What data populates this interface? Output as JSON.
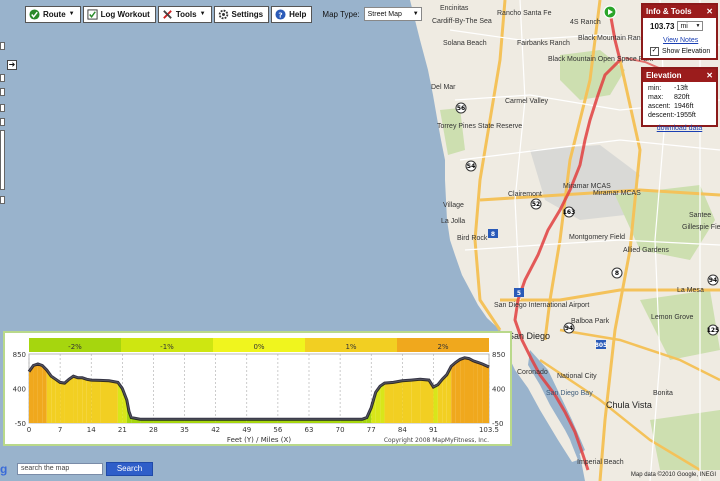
{
  "toolbar": {
    "route": "Route",
    "log_workout": "Log Workout",
    "tools": "Tools",
    "settings": "Settings",
    "help": "Help",
    "map_type_label": "Map Type:",
    "map_type_value": "Street Map"
  },
  "info_panel": {
    "title": "Info & Tools",
    "distance": "103.73",
    "unit": "mi",
    "view_notes": "View Notes",
    "show_elevation": "Show Elevation"
  },
  "elevation_panel": {
    "title": "Elevation",
    "min_label": "min:",
    "min_value": "-13ft",
    "max_label": "max:",
    "max_value": "820ft",
    "ascent_label": "ascent:",
    "ascent_value": "1946ft",
    "descent_label": "descent:",
    "descent_value": "-1955ft",
    "download": "download data"
  },
  "map_labels": [
    {
      "text": "Encinitas",
      "cls": ""
    },
    {
      "text": "Cardiff-By-The Sea",
      "cls": ""
    },
    {
      "text": "Rancho Santa Fe",
      "cls": ""
    },
    {
      "text": "4S Ranch",
      "cls": ""
    },
    {
      "text": "Solana Beach",
      "cls": ""
    },
    {
      "text": "Fairbanks Ranch",
      "cls": ""
    },
    {
      "text": "Black Mountain Ranch",
      "cls": ""
    },
    {
      "text": "Black Mountain Open Space Park",
      "cls": ""
    },
    {
      "text": "Del Mar",
      "cls": ""
    },
    {
      "text": "Carmel Valley",
      "cls": ""
    },
    {
      "text": "Torrey Pines State Reserve",
      "cls": ""
    },
    {
      "text": "Miramar MCAS",
      "cls": ""
    },
    {
      "text": "Miramar MCAS",
      "cls": ""
    },
    {
      "text": "Village",
      "cls": ""
    },
    {
      "text": "La Jolla",
      "cls": ""
    },
    {
      "text": "Bird Rock",
      "cls": ""
    },
    {
      "text": "Clairemont",
      "cls": ""
    },
    {
      "text": "Montgomery Field",
      "cls": ""
    },
    {
      "text": "Allied Gardens",
      "cls": ""
    },
    {
      "text": "Santee",
      "cls": ""
    },
    {
      "text": "Gillespie Field",
      "cls": ""
    },
    {
      "text": "La Mesa",
      "cls": ""
    },
    {
      "text": "Lemon Grove",
      "cls": ""
    },
    {
      "text": "San Diego International Airport",
      "cls": ""
    },
    {
      "text": "Balboa Park",
      "cls": ""
    },
    {
      "text": "San Diego",
      "cls": "big"
    },
    {
      "text": "Coronado",
      "cls": ""
    },
    {
      "text": "National City",
      "cls": ""
    },
    {
      "text": "San Diego Bay",
      "cls": "water"
    },
    {
      "text": "Chula Vista",
      "cls": "big"
    },
    {
      "text": "Bonita",
      "cls": ""
    },
    {
      "text": "Imperial Beach",
      "cls": ""
    }
  ],
  "chart_data": {
    "type": "area",
    "title": "",
    "xlabel": "Feet (Y) / Miles (X)",
    "ylabel": "",
    "copyright": "Copyright 2008 MapMyFitness, Inc.",
    "x_ticks": [
      "0",
      "7",
      "14",
      "21",
      "28",
      "35",
      "42",
      "49",
      "56",
      "63",
      "70",
      "77",
      "84",
      "91",
      "103.5"
    ],
    "y_ticks": [
      "850",
      "400",
      "-50"
    ],
    "y_ticks_right": [
      "850",
      "400",
      "-50"
    ],
    "ylim": [
      -50,
      850
    ],
    "xlim": [
      0,
      103.5
    ],
    "grade_bands": [
      {
        "label": "-2%",
        "color": "#a6d60e"
      },
      {
        "label": "-1%",
        "color": "#cee611"
      },
      {
        "label": "0%",
        "color": "#f0f51e"
      },
      {
        "label": "1%",
        "color": "#f2cf22"
      },
      {
        "label": "2%",
        "color": "#f0a81d"
      }
    ],
    "series": [
      {
        "x": [
          0,
          1,
          2,
          3,
          4,
          5,
          6,
          7,
          8,
          9,
          10,
          11,
          12,
          13,
          14,
          16,
          18,
          20,
          21,
          22,
          22.5,
          23,
          25,
          28,
          35,
          42,
          49,
          56,
          63,
          70,
          75,
          76,
          77,
          78,
          79,
          80,
          82,
          84,
          86,
          88,
          90,
          91,
          92,
          93,
          94,
          95,
          96,
          97,
          98,
          99,
          100,
          101,
          102,
          103.5
        ],
        "y": [
          620,
          700,
          720,
          700,
          640,
          560,
          520,
          480,
          470,
          520,
          560,
          540,
          540,
          520,
          510,
          505,
          500,
          480,
          400,
          250,
          100,
          20,
          0,
          0,
          0,
          0,
          0,
          0,
          0,
          0,
          0,
          20,
          150,
          350,
          430,
          470,
          480,
          500,
          510,
          520,
          510,
          420,
          450,
          520,
          580,
          690,
          740,
          780,
          800,
          790,
          760,
          740,
          720,
          680
        ]
      }
    ]
  }
}
